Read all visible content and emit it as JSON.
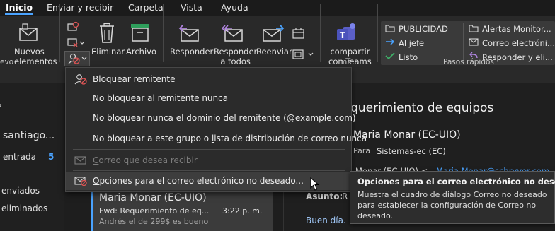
{
  "tabs": [
    {
      "label": "Inicio",
      "active": true
    },
    {
      "label": "Enviar y recibir"
    },
    {
      "label": "Carpeta"
    },
    {
      "label": "Vista"
    },
    {
      "label": "Ayuda"
    }
  ],
  "ribbon": {
    "new_items_label": "Nuevos elementos",
    "new_items_chevron": "⌄",
    "group_new_suffix": "evo",
    "delete_label": "Eliminar",
    "archive_label": "Archivo",
    "reply_label": "Responder",
    "reply_all_label_1": "Responder",
    "reply_all_label_2": "a todos",
    "forward_label": "Reenviar",
    "teams_label_1": "compartir",
    "teams_label_2": "con Teams",
    "teams_group_suffix": "ms",
    "quick_steps": {
      "group_name": "Pasos rápidos",
      "items": [
        "PUBLICIDAD",
        "Al jefe",
        "Listo",
        "Alertas Monitor...",
        "Correo electróni...",
        "Responder y eli..."
      ]
    }
  },
  "leftnav": {
    "account": "santiago...",
    "inbox_label": "entrada",
    "inbox_count": "5",
    "sent_label": "enviados",
    "deleted_label": "eliminados"
  },
  "message": {
    "sender": "Maria Monar (EC-UIO)",
    "subject": "Fwd: Requerimiento de eq...",
    "time": "3:22 p. m.",
    "preview": "Andrés el de 299$ es bueno"
  },
  "reading": {
    "subject": "requerimiento de equipos",
    "from": "Maria Monar (EC-UIO)",
    "to_label": "Para",
    "to_value": "Sistemas-ec (EC)",
    "from_line": "Monar (EC-UIO) <",
    "email_link": "Maria.Monar@schryver.com",
    "subject_label": "Asunto:",
    "subject_value": "R",
    "body_start": "Buen día."
  },
  "menu": {
    "items": [
      {
        "key": "B",
        "rest": "loquear remitente"
      },
      {
        "pre": "No bloquear al ",
        "key": "r",
        "rest": "emitente nunca"
      },
      {
        "pre": "No bloquear nunca el ",
        "key": "d",
        "rest": "ominio del remitente (@example.com)"
      },
      {
        "pre": "No bloquear a este grupo o ",
        "key": "l",
        "rest": "ista de distribución de correo nunca"
      },
      {
        "pre": "",
        "key": "C",
        "rest": "orreo que desea recibir"
      },
      {
        "pre": "",
        "key": "O",
        "rest": "pciones para el correo electrónico no deseado..."
      }
    ]
  },
  "tooltip": {
    "title": "Opciones para el correo electrónico no deseado",
    "body": "Muestra el cuadro de diálogo Correo no deseado para establecer la configuración de Correo no deseado."
  }
}
